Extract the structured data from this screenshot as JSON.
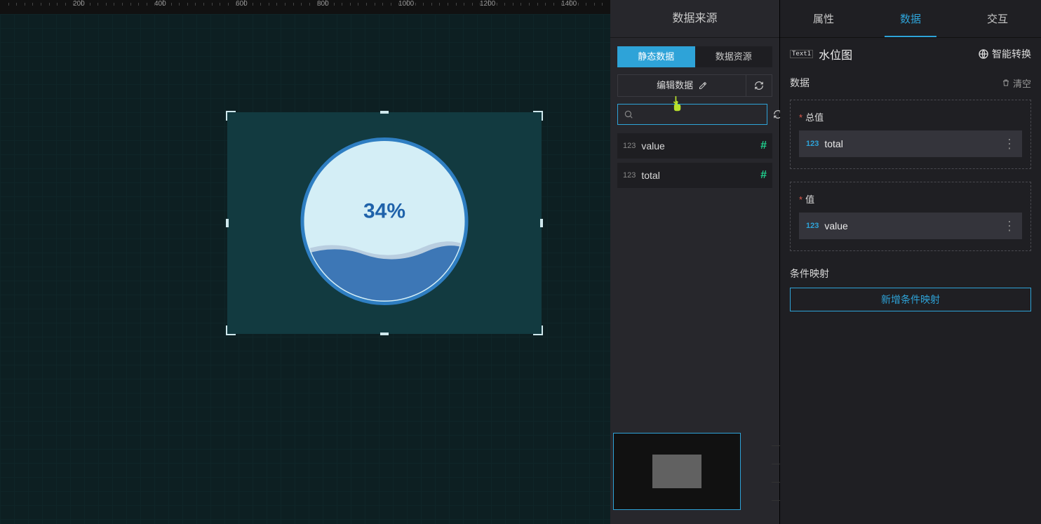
{
  "ruler": {
    "marks": [
      200,
      400,
      600,
      800,
      1000,
      1200,
      1400
    ]
  },
  "canvas": {
    "percent_label": "34%"
  },
  "chart_data": {
    "type": "pie",
    "subtype": "liquid-fill",
    "title": "",
    "value": 34,
    "total": 100,
    "percent": 34,
    "label": "34%"
  },
  "ds_panel": {
    "title": "数据来源",
    "tabs": {
      "static": "静态数据",
      "resource": "数据资源"
    },
    "edit_label": "编辑数据",
    "search_placeholder": "",
    "fields": [
      {
        "type": "123",
        "name": "value"
      },
      {
        "type": "123",
        "name": "total"
      }
    ]
  },
  "prop_panel": {
    "tabs": {
      "attr": "属性",
      "data": "数据",
      "inter": "交互"
    },
    "badge": "Text1",
    "title": "水位图",
    "ai_label": "智能转换",
    "section_title": "数据",
    "clear_label": "清空",
    "groups": [
      {
        "label": "总值",
        "chip_type": "123",
        "chip_name": "total"
      },
      {
        "label": "值",
        "chip_type": "123",
        "chip_name": "value"
      }
    ],
    "cond_title": "条件映射",
    "add_cond": "新增条件映射"
  }
}
